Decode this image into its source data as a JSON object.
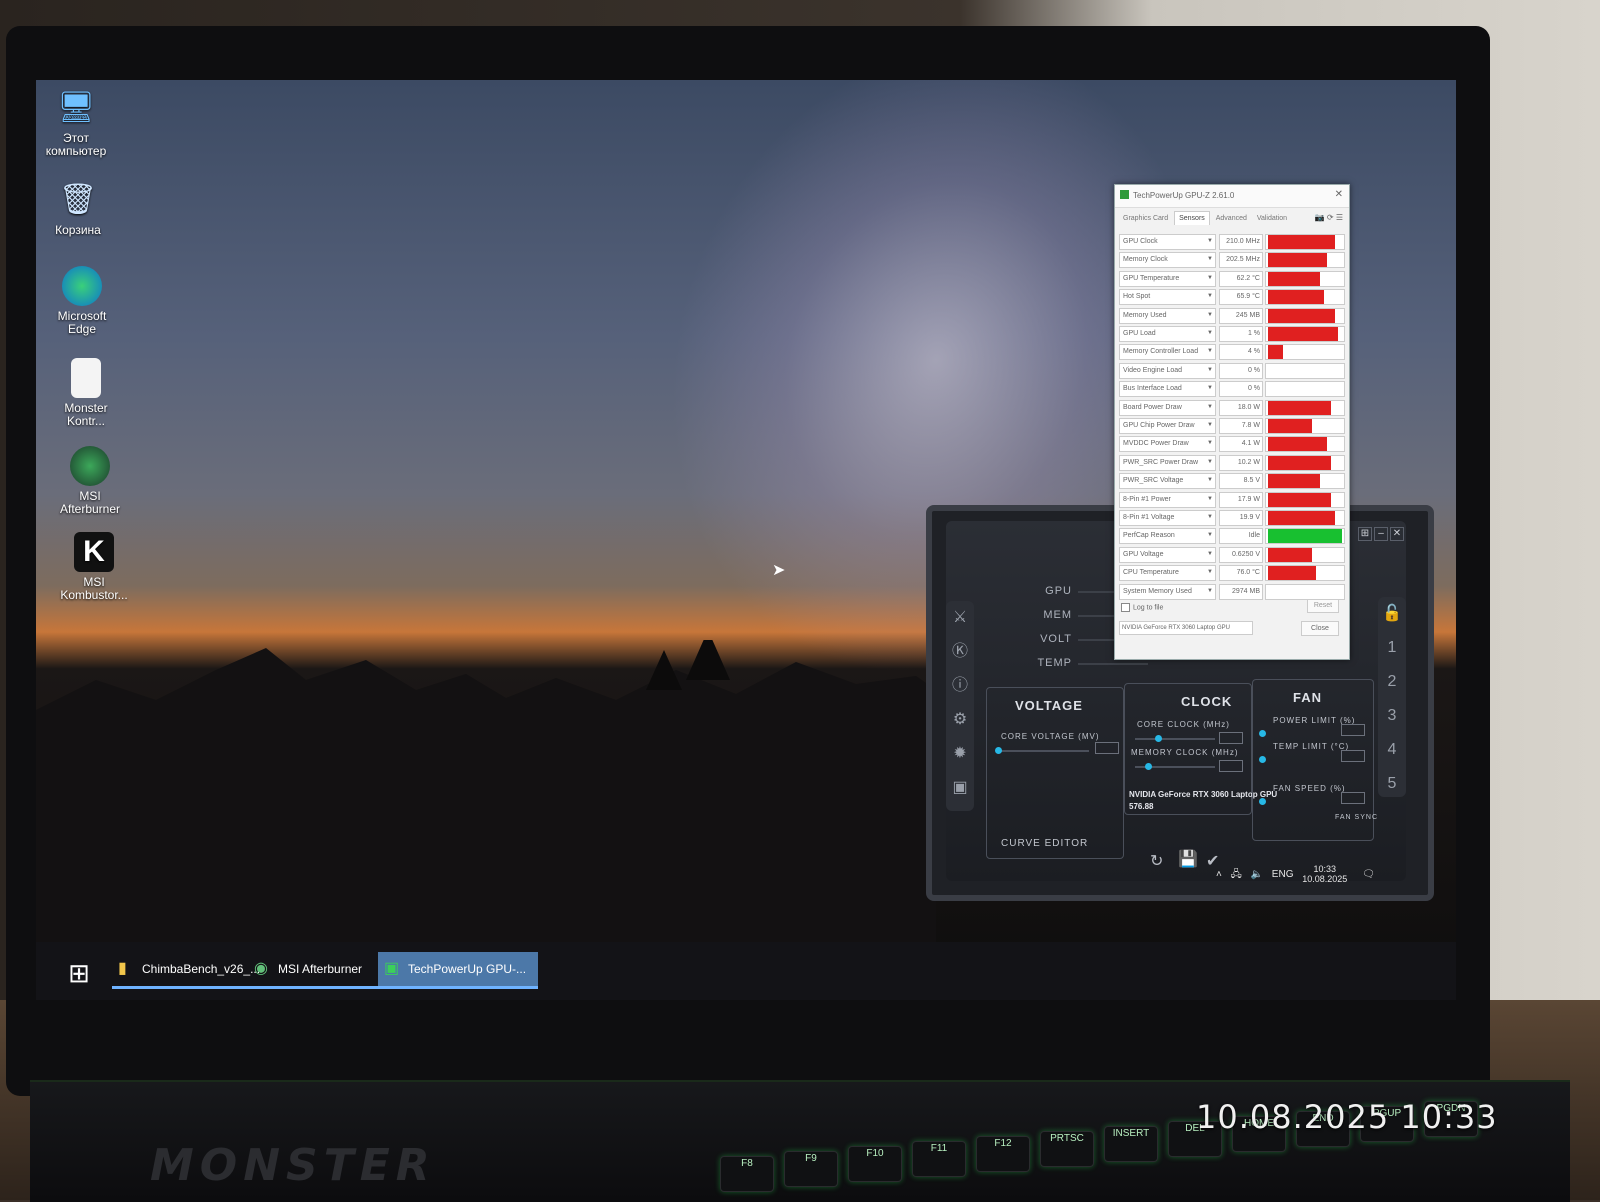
{
  "desktop": {
    "icons": [
      {
        "label": "Этот компьютер",
        "icon": "computer-icon"
      },
      {
        "label": "Корзина",
        "icon": "recycle-bin-icon"
      },
      {
        "label": "Microsoft Edge",
        "icon": "edge-icon"
      },
      {
        "label": "Monster Kontr...",
        "icon": "file-shortcut-icon"
      },
      {
        "label": "MSI Afterburner",
        "icon": "afterburner-icon"
      },
      {
        "label": "MSI Kombustor...",
        "icon": "kombustor-icon"
      }
    ]
  },
  "taskbar": {
    "items": [
      {
        "label": "ChimbaBench_v26_...",
        "icon": "folder-icon"
      },
      {
        "label": "MSI Afterburner",
        "icon": "afterburner-icon"
      },
      {
        "label": "TechPowerUp GPU-...",
        "icon": "gpuz-icon",
        "active": true
      }
    ],
    "tray": {
      "lang": "ENG",
      "time": "10:33",
      "date": "10.08.2025"
    }
  },
  "gpuz": {
    "title": "TechPowerUp GPU-Z 2.61.0",
    "tabs": [
      "Graphics Card",
      "Sensors",
      "Advanced",
      "Validation"
    ],
    "active_tab": "Sensors",
    "sensors": [
      {
        "name": "GPU Clock",
        "value": "210.0 MHz",
        "level": 0.9,
        "color": "#e02020"
      },
      {
        "name": "Memory Clock",
        "value": "202.5 MHz",
        "level": 0.8,
        "color": "#e02020"
      },
      {
        "name": "GPU Temperature",
        "value": "62.2 °C",
        "level": 0.7,
        "color": "#e02020"
      },
      {
        "name": "Hot Spot",
        "value": "65.9 °C",
        "level": 0.75,
        "color": "#e02020"
      },
      {
        "name": "Memory Used",
        "value": "245 MB",
        "level": 0.9,
        "color": "#e02020"
      },
      {
        "name": "GPU Load",
        "value": "1 %",
        "level": 0.95,
        "color": "#e02020"
      },
      {
        "name": "Memory Controller Load",
        "value": "4 %",
        "level": 0.2,
        "color": "#e02020"
      },
      {
        "name": "Video Engine Load",
        "value": "0 %",
        "level": 0.0,
        "color": "#e02020"
      },
      {
        "name": "Bus Interface Load",
        "value": "0 %",
        "level": 0.0,
        "color": "#e02020"
      },
      {
        "name": "Board Power Draw",
        "value": "18.0 W",
        "level": 0.85,
        "color": "#e02020"
      },
      {
        "name": "GPU Chip Power Draw",
        "value": "7.8 W",
        "level": 0.6,
        "color": "#e02020"
      },
      {
        "name": "MVDDC Power Draw",
        "value": "4.1 W",
        "level": 0.8,
        "color": "#e02020"
      },
      {
        "name": "PWR_SRC Power Draw",
        "value": "10.2 W",
        "level": 0.85,
        "color": "#e02020"
      },
      {
        "name": "PWR_SRC Voltage",
        "value": "8.5 V",
        "level": 0.7,
        "color": "#e02020"
      },
      {
        "name": "8-Pin #1 Power",
        "value": "17.9 W",
        "level": 0.85,
        "color": "#e02020"
      },
      {
        "name": "8-Pin #1 Voltage",
        "value": "19.9 V",
        "level": 0.9,
        "color": "#e02020"
      },
      {
        "name": "PerfCap Reason",
        "value": "Idle",
        "level": 1.0,
        "color": "#18c030"
      },
      {
        "name": "GPU Voltage",
        "value": "0.6250 V",
        "level": 0.6,
        "color": "#e02020"
      },
      {
        "name": "CPU Temperature",
        "value": "76.0 °C",
        "level": 0.65,
        "color": "#e02020"
      },
      {
        "name": "System Memory Used",
        "value": "2974 MB",
        "level": 0.0,
        "color": "#e02020"
      }
    ],
    "log_label": "Log to file",
    "reset_label": "Reset",
    "device": "NVIDIA GeForce RTX 3060 Laptop GPU",
    "close_label": "Close"
  },
  "afterburner": {
    "monitors": [
      "GPU",
      "MEM",
      "VOLT",
      "TEMP"
    ],
    "voltage_title": "VOLTAGE",
    "clock_title": "CLOCK",
    "fan_title": "FAN",
    "core_voltage_label": "CORE VOLTAGE (MV)",
    "core_clock_label": "CORE CLOCK (MHz)",
    "memory_clock_label": "MEMORY CLOCK (MHz)",
    "power_limit_label": "POWER LIMIT (%)",
    "temp_limit_label": "TEMP LIMIT (°C)",
    "fan_speed_label": "FAN SPEED (%)",
    "gpu_name": "NVIDIA GeForce RTX 3060 Laptop GPU",
    "driver": "576.88",
    "curve_editor_label": "CURVE EDITOR",
    "fan_sync_label": "FAN SYNC",
    "profiles": [
      "1",
      "2",
      "3",
      "4",
      "5"
    ]
  },
  "keyboard": {
    "brand": "MONSTER",
    "keys": [
      "F8",
      "F9",
      "F10",
      "F11",
      "F12",
      "PRTSC",
      "INSERT",
      "DEL",
      "HOME",
      "END",
      "PGUP",
      "PGDN"
    ]
  },
  "photo_timestamp": "10.08.2025 10:33"
}
